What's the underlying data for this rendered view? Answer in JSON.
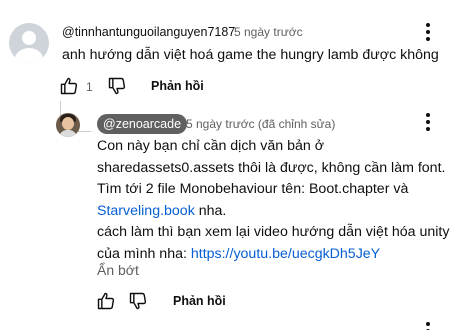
{
  "comment": {
    "author": "@tinnhantunguoilanguyen7187",
    "time": "5 ngày trước",
    "text": "anh hướng dẫn việt hoá game the hungry lamb được không",
    "like_count": "1",
    "reply_label": "Phản hồi"
  },
  "reply": {
    "author": "@zenoarcade",
    "time": "5 ngày trước (đã chỉnh sửa)",
    "lines": {
      "l1": "Con này bạn chỉ cần dịch văn bản ở",
      "l2": "sharedassets0.assets thôi là được, không cần làm font.",
      "l3": "Tìm tới 2 file Monobehaviour tên: Boot.chapter và",
      "l4_link": "Starveling.book",
      "l4_rest": " nha.",
      "l5": "cách làm thì bạn xem lại video hướng dẫn việt hóa unity",
      "l6_text": "của mình nha: ",
      "l6_link": "https://youtu.be/uecgkDh5JeY"
    },
    "collapse_label": "Ẩn bớt",
    "reply_label": "Phản hồi"
  },
  "colors": {
    "link": "#065fd4",
    "secondary_text": "#606060",
    "chip_bg": "#606060"
  },
  "icons": [
    "default-avatar-icon",
    "more-vert-icon",
    "thumb-up-icon",
    "thumb-down-icon",
    "channel-avatar-icon"
  ]
}
